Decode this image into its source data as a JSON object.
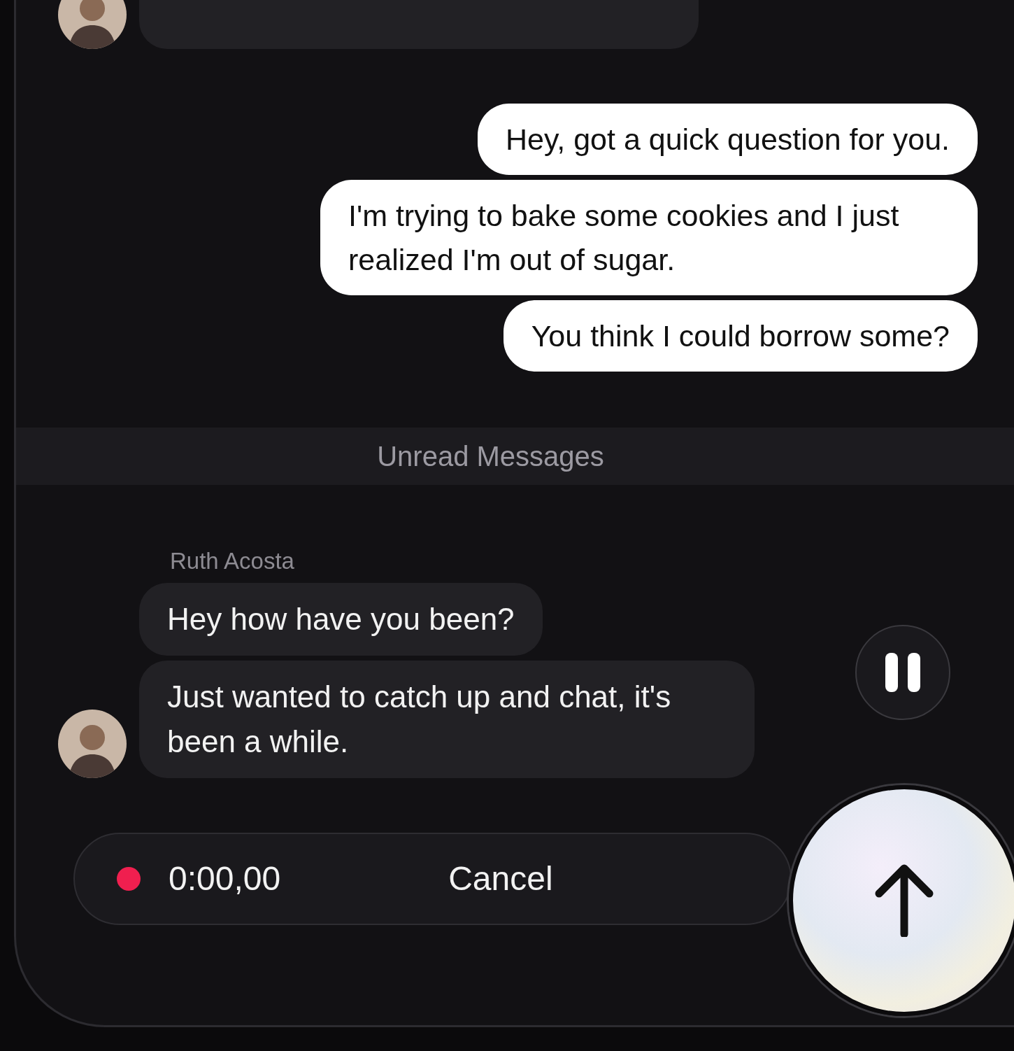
{
  "outgoing": [
    {
      "text": "Hey, got a quick question for you."
    },
    {
      "text": "I'm trying to bake some cookies and I just realized I'm out of sugar."
    },
    {
      "text": "You think I could borrow some?"
    }
  ],
  "divider": {
    "label": "Unread Messages"
  },
  "incoming": {
    "sender": "Ruth Acosta",
    "messages": [
      {
        "text": "Hey how have you been?"
      },
      {
        "text": "Just wanted to catch up and chat, it's been a while."
      }
    ]
  },
  "recorder": {
    "recording": true,
    "time": "0:00,00",
    "cancel": "Cancel"
  }
}
